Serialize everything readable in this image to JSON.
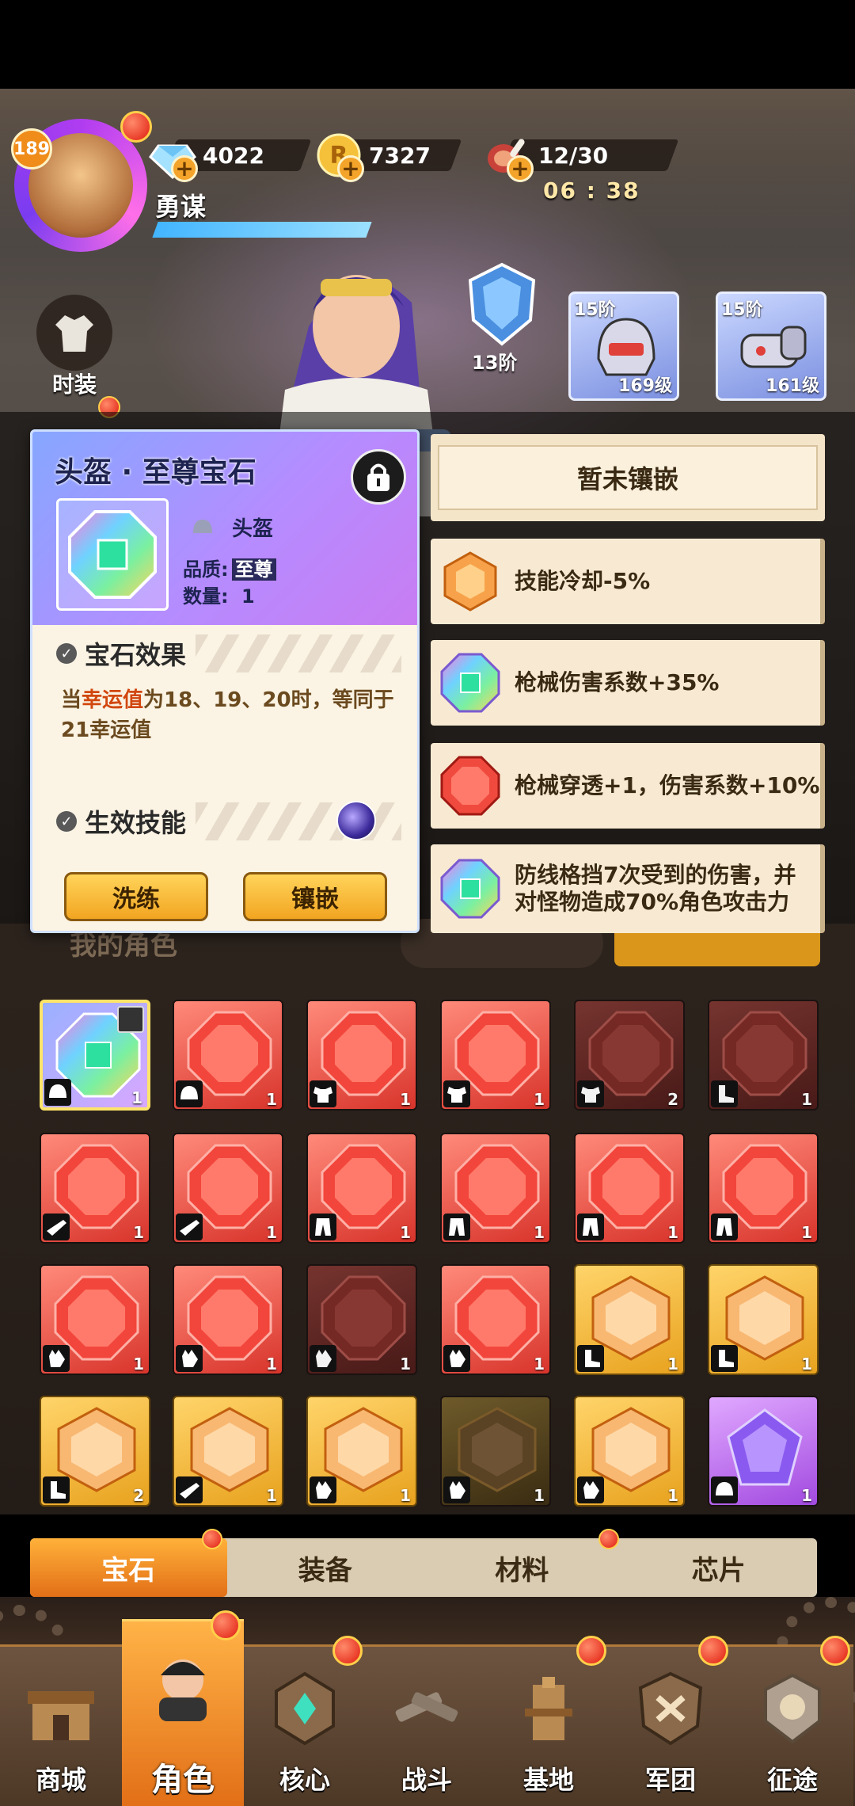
{
  "player": {
    "level": "189",
    "name": "勇谋"
  },
  "resources": [
    {
      "name": "diamond",
      "icon": "diamond-icon",
      "value": "4022"
    },
    {
      "name": "gold",
      "icon": "gold-coin-icon",
      "value": "7327"
    },
    {
      "name": "stamina",
      "icon": "meat-icon",
      "value": "12/30"
    }
  ],
  "timer": "06 : 38",
  "sidebar": {
    "outfit_label": "时装"
  },
  "equipment": {
    "shield_tier": "13阶",
    "slots": [
      {
        "tier": "15阶",
        "level": "169级"
      },
      {
        "tier": "15阶",
        "level": "161级"
      }
    ]
  },
  "popup": {
    "title": "头盔 · 至尊宝石",
    "slot_label": "头盔",
    "quality_label": "品质:",
    "quality_value": "至尊",
    "count_label": "数量:",
    "count_value": "1",
    "effect_header": "宝石效果",
    "effect_prefix": "当",
    "effect_highlight": "幸运值",
    "effect_rest": "为18、19、20时，等同于21幸运值",
    "skill_header": "生效技能",
    "btn_refine": "洗练",
    "btn_inlay": "镶嵌"
  },
  "inlay_list": {
    "not_inlaid": "暂未镶嵌",
    "items": [
      {
        "gem": "orange",
        "text": "技能冷却-5%"
      },
      {
        "gem": "rainbow",
        "text": "枪械伤害系数+35%"
      },
      {
        "gem": "red",
        "text": "枪械穿透+1，伤害系数+10%"
      },
      {
        "gem": "rainbow",
        "text": "防线格挡7次受到的伤害，并对怪物造成70%角色攻击力"
      }
    ]
  },
  "behind": {
    "my_role": "我的角色"
  },
  "inventory": [
    {
      "color": "rainbow",
      "count": "1",
      "slot": "helmet",
      "locked": true
    },
    {
      "color": "red",
      "count": "1",
      "slot": "helmet"
    },
    {
      "color": "red",
      "count": "1",
      "slot": "armor"
    },
    {
      "color": "red",
      "count": "1",
      "slot": "armor"
    },
    {
      "color": "reddim",
      "count": "2",
      "slot": "armor"
    },
    {
      "color": "reddim",
      "count": "1",
      "slot": "boots"
    },
    {
      "color": "red",
      "count": "1",
      "slot": "gun"
    },
    {
      "color": "red",
      "count": "1",
      "slot": "gun"
    },
    {
      "color": "red",
      "count": "1",
      "slot": "pants"
    },
    {
      "color": "red",
      "count": "1",
      "slot": "pants"
    },
    {
      "color": "red",
      "count": "1",
      "slot": "pants"
    },
    {
      "color": "red",
      "count": "1",
      "slot": "pants"
    },
    {
      "color": "red",
      "count": "1",
      "slot": "glove"
    },
    {
      "color": "red",
      "count": "1",
      "slot": "glove"
    },
    {
      "color": "reddim",
      "count": "1",
      "slot": "glove"
    },
    {
      "color": "red",
      "count": "1",
      "slot": "glove"
    },
    {
      "color": "orange",
      "count": "1",
      "slot": "boots"
    },
    {
      "color": "orange",
      "count": "1",
      "slot": "boots"
    },
    {
      "color": "orange",
      "count": "2",
      "slot": "boots"
    },
    {
      "color": "orange",
      "count": "1",
      "slot": "gun"
    },
    {
      "color": "orange",
      "count": "1",
      "slot": "glove"
    },
    {
      "color": "orangedim",
      "count": "1",
      "slot": "glove"
    },
    {
      "color": "orange",
      "count": "1",
      "slot": "glove"
    },
    {
      "color": "purple",
      "count": "1",
      "slot": "helmet"
    }
  ],
  "tabs": [
    {
      "label": "宝石",
      "active": true,
      "dot": true
    },
    {
      "label": "装备",
      "active": false,
      "dot": false
    },
    {
      "label": "材料",
      "active": false,
      "dot": true
    },
    {
      "label": "芯片",
      "active": false,
      "dot": false
    }
  ],
  "nav": [
    {
      "label": "商城",
      "icon": "shop-icon",
      "dot": false,
      "active": false
    },
    {
      "label": "角色",
      "icon": "character-icon",
      "dot": true,
      "active": true
    },
    {
      "label": "核心",
      "icon": "core-icon",
      "dot": true,
      "active": false
    },
    {
      "label": "战斗",
      "icon": "battle-icon",
      "dot": false,
      "active": false
    },
    {
      "label": "基地",
      "icon": "base-icon",
      "dot": true,
      "active": false
    },
    {
      "label": "军团",
      "icon": "legion-icon",
      "dot": true,
      "active": false
    },
    {
      "label": "征途",
      "icon": "journey-icon",
      "dot": true,
      "active": false
    }
  ]
}
